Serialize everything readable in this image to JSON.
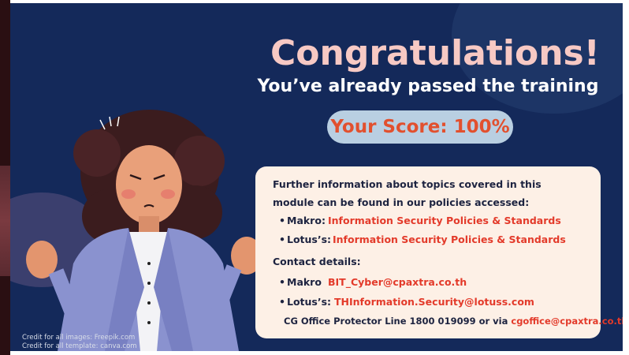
{
  "slide": {
    "title": "Congratulations!",
    "subtitle": "You’ve already passed the training",
    "score": "Your Score: 100%"
  },
  "card": {
    "intro_line1": "Further information about topics covered in this",
    "intro_line2": "module can be found in our policies accessed:",
    "policies": [
      {
        "bullet": "•",
        "label": "Makro:",
        "link": "Information Security Policies & Standards"
      },
      {
        "bullet": "•",
        "label": "Lotus’s:",
        "link": "Information Security Policies & Standards"
      }
    ],
    "contact_heading": "Contact details:",
    "contacts": [
      {
        "bullet": "•",
        "label": "Makro",
        "email": "BIT_Cyber@cpaxtra.co.th"
      },
      {
        "bullet": "•",
        "label": "Lotus’s:",
        "email": "THInformation.Security@lotuss.com"
      }
    ],
    "footer_text": "CG Office Protector Line 1800 019099 or via",
    "footer_email": "cgoffice@cpaxtra.co.th"
  },
  "credits": {
    "images": "Credit for all images: Freepik.com",
    "template": "Credit for all template: canva.com"
  },
  "colors": {
    "background": "#14295a",
    "title": "#f7c9c4",
    "score_bg": "#b9cfe2",
    "score_text": "#e2502e",
    "card_bg": "#fdf0e6",
    "link_red": "#e33a2a"
  }
}
